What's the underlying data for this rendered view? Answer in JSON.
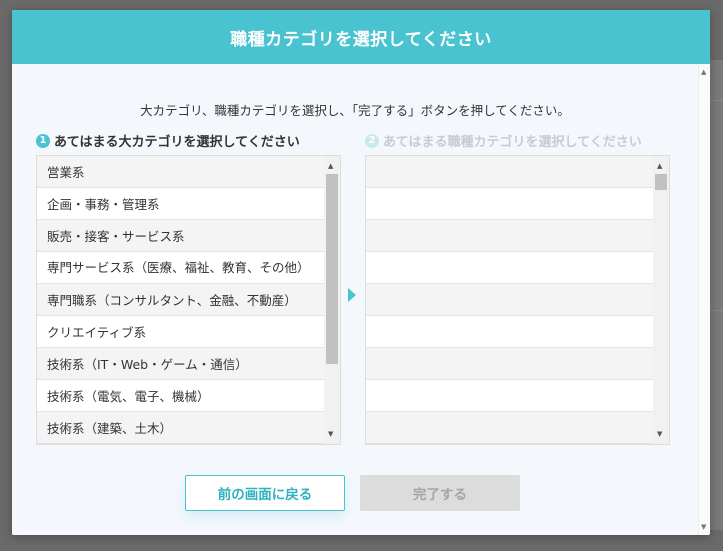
{
  "modal": {
    "title": "職種カテゴリを選択してください",
    "instruction": "大カテゴリ、職種カテゴリを選択し、「完了する」ボタンを押してください。"
  },
  "step1": {
    "number": "1",
    "label": "あてはまる大カテゴリを選択してください"
  },
  "step2": {
    "number": "2",
    "label": "あてはまる職種カテゴリを選択してください"
  },
  "major_categories": [
    "営業系",
    "企画・事務・管理系",
    "販売・接客・サービス系",
    "専門サービス系（医療、福祉、教育、その他）",
    "専門職系（コンサルタント、金融、不動産）",
    "クリエイティブ系",
    "技術系（IT・Web・ゲーム・通信）",
    "技術系（電気、電子、機械）",
    "技術系（建築、土木）"
  ],
  "buttons": {
    "back": "前の画面に戻る",
    "done": "完了する"
  },
  "colors": {
    "accent": "#4ac3d0",
    "disabled_bg": "#dcdcdc",
    "disabled_text": "#a5a5a5"
  }
}
